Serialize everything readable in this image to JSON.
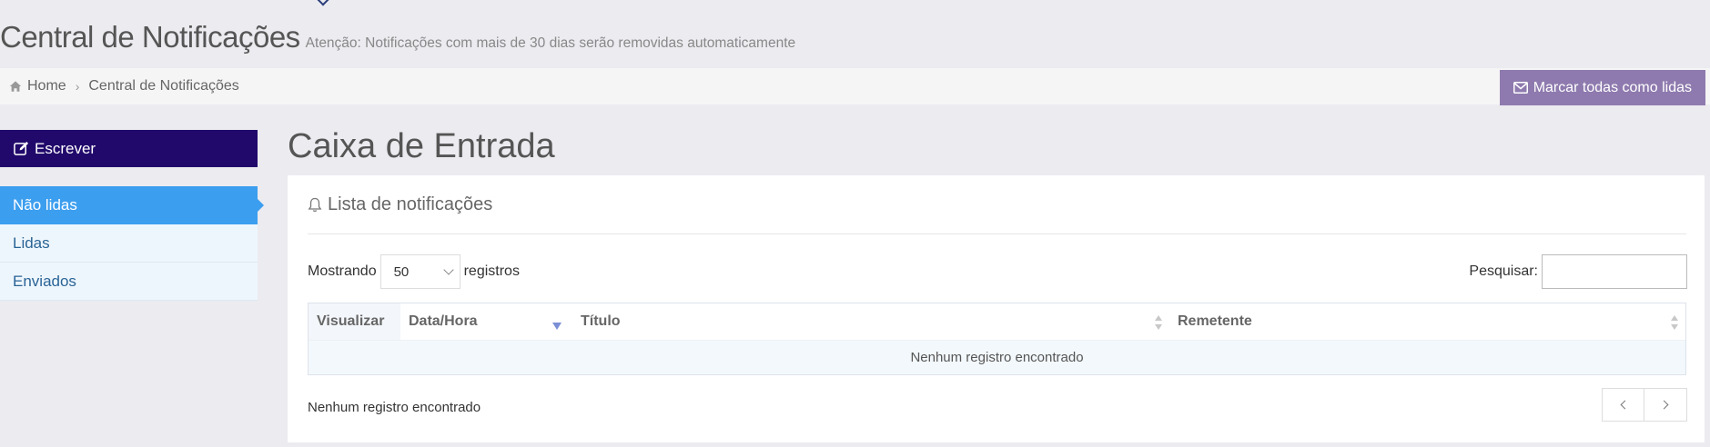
{
  "header": {
    "title": "Central de Notificações",
    "subtitle": "Atenção: Notificações com mais de 30 dias serão removidas automaticamente"
  },
  "breadcrumb": {
    "home": "Home",
    "current": "Central de Notificações"
  },
  "actions": {
    "mark_all_read": "Marcar todas como lidas"
  },
  "sidebar": {
    "compose": "Escrever",
    "folders": [
      {
        "label": "Não lidas",
        "active": true
      },
      {
        "label": "Lidas",
        "active": false
      },
      {
        "label": "Enviados",
        "active": false
      }
    ]
  },
  "main": {
    "title": "Caixa de Entrada",
    "panel_title": "Lista de notificações",
    "length": {
      "prefix": "Mostrando",
      "value": "50",
      "suffix": "registros"
    },
    "search": {
      "label": "Pesquisar:",
      "value": ""
    },
    "table": {
      "columns": [
        "Visualizar",
        "Data/Hora",
        "Título",
        "Remetente"
      ],
      "empty_message": "Nenhum registro encontrado"
    },
    "info": "Nenhum registro encontrado"
  },
  "colors": {
    "compose_bg": "#21096b",
    "active_folder": "#3c9eef",
    "mark_all_bg": "#8e7aae",
    "background": "#ebebf0"
  }
}
